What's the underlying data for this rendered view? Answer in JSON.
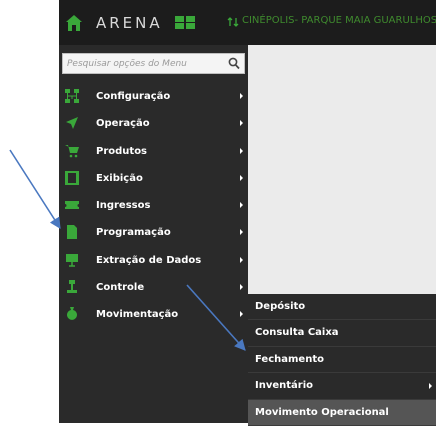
{
  "header": {
    "brand": "ARENA",
    "location": "CINÉPOLIS- PARQUE MAIA GUARULHOS"
  },
  "search": {
    "placeholder": "Pesquisar opções do Menu"
  },
  "menu": {
    "items": [
      {
        "label": "Configuração",
        "icon": "sitemap-icon",
        "color": "#3aa83a"
      },
      {
        "label": "Operação",
        "icon": "send-icon",
        "color": "#3aa83a"
      },
      {
        "label": "Produtos",
        "icon": "cart-icon",
        "color": "#3aa83a"
      },
      {
        "label": "Exibição",
        "icon": "film-icon",
        "color": "#3aa83a"
      },
      {
        "label": "Ingressos",
        "icon": "ticket-icon",
        "color": "#3aa83a"
      },
      {
        "label": "Programação",
        "icon": "file-icon",
        "color": "#3aa83a"
      },
      {
        "label": "Extração de Dados",
        "icon": "chart-icon",
        "color": "#3aa83a"
      },
      {
        "label": "Controle",
        "icon": "gavel-icon",
        "color": "#3aa83a"
      },
      {
        "label": "Movimentação",
        "icon": "money-bag-icon",
        "color": "#3aa83a"
      }
    ]
  },
  "submenu": {
    "items": [
      {
        "label": "Depósito"
      },
      {
        "label": "Consulta Caixa"
      },
      {
        "label": "Fechamento"
      },
      {
        "label": "Inventário"
      },
      {
        "label": "Movimento Operacional"
      }
    ]
  },
  "colors": {
    "accent": "#3aa83a",
    "annotation_arrow": "#4a78c0"
  }
}
